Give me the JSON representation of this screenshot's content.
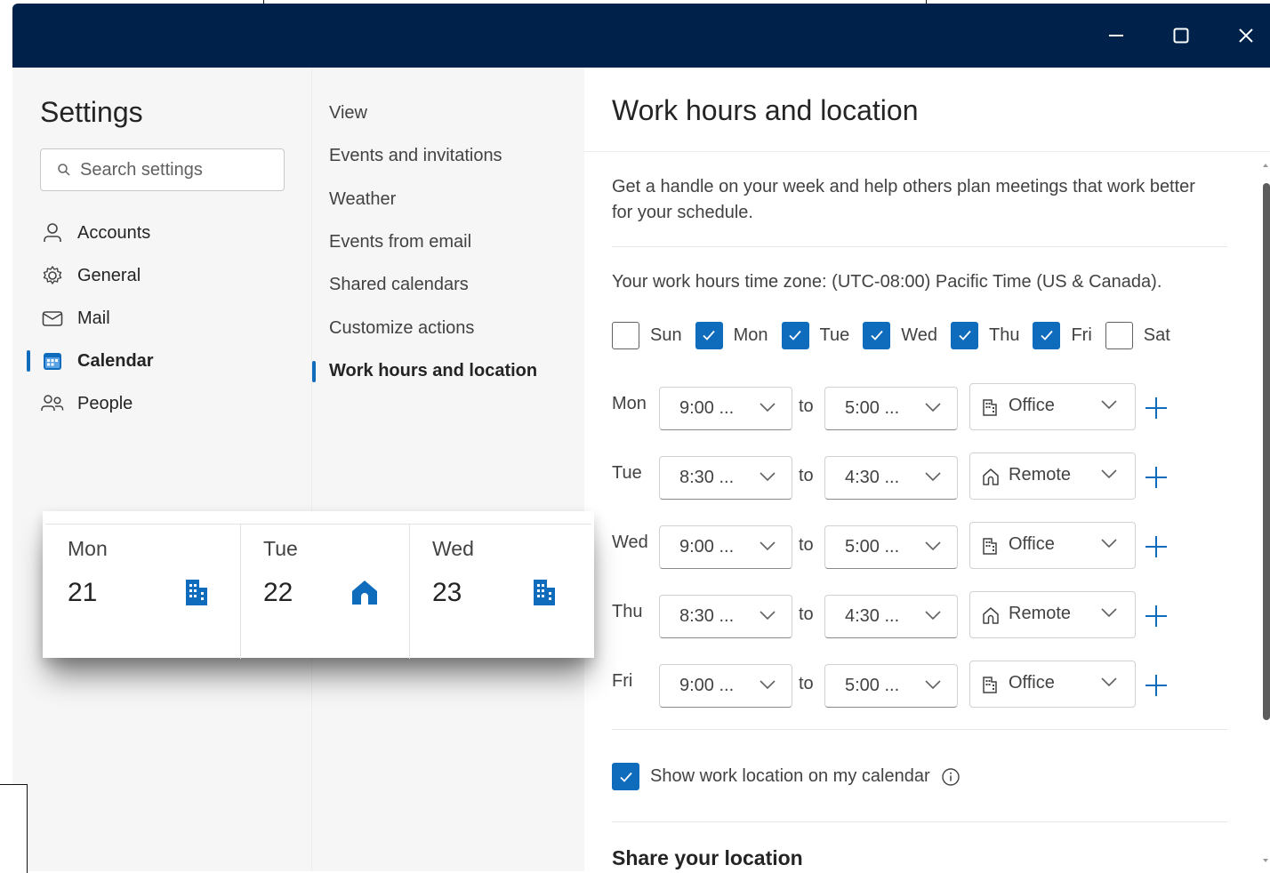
{
  "window": {
    "controls": [
      "minimize-icon",
      "maximize-icon",
      "close-icon"
    ]
  },
  "sidebar": {
    "title": "Settings",
    "search_placeholder": "Search settings",
    "items": [
      {
        "label": "Accounts",
        "icon": "person-icon"
      },
      {
        "label": "General",
        "icon": "gear-icon"
      },
      {
        "label": "Mail",
        "icon": "mail-icon"
      },
      {
        "label": "Calendar",
        "icon": "calendar-icon",
        "selected": true
      },
      {
        "label": "People",
        "icon": "people-icon"
      }
    ]
  },
  "submenu": {
    "items": [
      {
        "label": "View"
      },
      {
        "label": "Events and invitations"
      },
      {
        "label": "Weather"
      },
      {
        "label": "Events from email"
      },
      {
        "label": "Shared calendars"
      },
      {
        "label": "Customize actions"
      },
      {
        "label": "Work hours and location",
        "selected": true
      }
    ]
  },
  "content": {
    "title": "Work hours and location",
    "description": "Get a handle on your week and help others plan meetings that work better for your schedule.",
    "timezone": "Your work hours time zone: (UTC-08:00) Pacific Time (US & Canada).",
    "days": [
      {
        "label": "Sun",
        "checked": false
      },
      {
        "label": "Mon",
        "checked": true
      },
      {
        "label": "Tue",
        "checked": true
      },
      {
        "label": "Wed",
        "checked": true
      },
      {
        "label": "Thu",
        "checked": true
      },
      {
        "label": "Fri",
        "checked": true
      },
      {
        "label": "Sat",
        "checked": false
      }
    ],
    "to_label": "to",
    "rows": [
      {
        "day": "Mon",
        "start": "9:00 ...",
        "end": "5:00 ...",
        "location": "Office",
        "location_icon": "building-icon"
      },
      {
        "day": "Tue",
        "start": "8:30 ...",
        "end": "4:30 ...",
        "location": "Remote",
        "location_icon": "home-icon"
      },
      {
        "day": "Wed",
        "start": "9:00 ...",
        "end": "5:00 ...",
        "location": "Office",
        "location_icon": "building-icon"
      },
      {
        "day": "Thu",
        "start": "8:30 ...",
        "end": "4:30 ...",
        "location": "Remote",
        "location_icon": "home-icon"
      },
      {
        "day": "Fri",
        "start": "9:00 ...",
        "end": "5:00 ...",
        "location": "Office",
        "location_icon": "building-icon"
      }
    ],
    "show_location": {
      "label": "Show work location on my calendar",
      "checked": true
    },
    "share_title": "Share your location"
  },
  "preview": {
    "days": [
      {
        "day": "Mon",
        "date": "21",
        "icon": "building-icon"
      },
      {
        "day": "Tue",
        "date": "22",
        "icon": "home-icon"
      },
      {
        "day": "Wed",
        "date": "23",
        "icon": "building-icon"
      }
    ]
  },
  "colors": {
    "titlebar": "#00214a",
    "accent": "#0f6cbd",
    "sidebar_bg": "#f6f6f6"
  }
}
